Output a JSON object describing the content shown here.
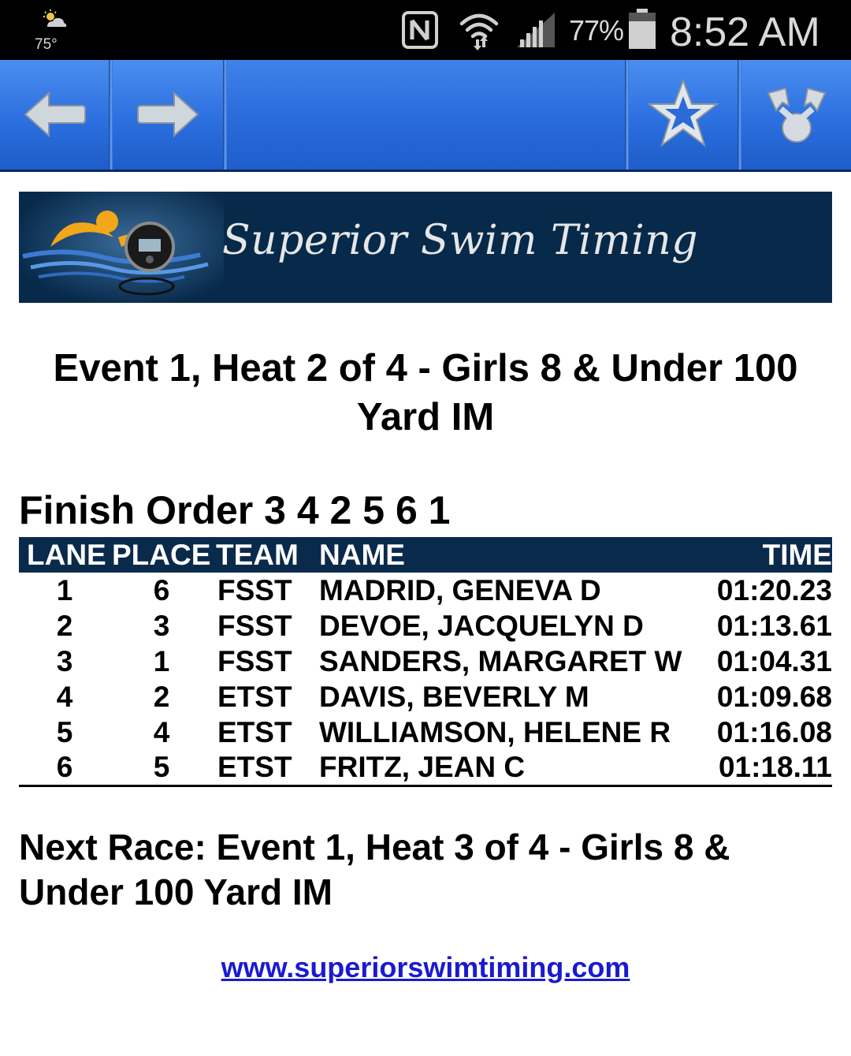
{
  "status_bar": {
    "weather_temp": "75°",
    "weather_icon": "partly-cloudy-icon",
    "nfc_icon": "nfc-icon",
    "wifi_icon": "wifi-icon",
    "signal_icon": "cell-signal-icon",
    "battery_percent": "77%",
    "battery_level": 0.77,
    "battery_icon": "battery-icon",
    "time": "8:52 AM"
  },
  "toolbar": {
    "back_icon": "arrow-left-icon",
    "forward_icon": "arrow-right-icon",
    "favorite_icon": "star-icon",
    "share_icon": "share-icon",
    "color": "#2f73e0"
  },
  "banner": {
    "title": "Superior Swim Timing",
    "background_color": "#07294a"
  },
  "event": {
    "title": "Event 1, Heat 2 of 4 - Girls 8 & Under 100 Yard IM"
  },
  "finish_order": {
    "text": "Finish Order 3 4 2 5 6 1"
  },
  "results": {
    "headers": {
      "lane": "LANE",
      "place": "PLACE",
      "team": "TEAM",
      "name": "NAME",
      "time": "TIME"
    },
    "rows": [
      {
        "lane": "1",
        "place": "6",
        "team": "FSST",
        "name": "MADRID, GENEVA D",
        "time": "01:20.23"
      },
      {
        "lane": "2",
        "place": "3",
        "team": "FSST",
        "name": "DEVOE, JACQUELYN D",
        "time": "01:13.61"
      },
      {
        "lane": "3",
        "place": "1",
        "team": "FSST",
        "name": "SANDERS, MARGARET W",
        "time": "01:04.31"
      },
      {
        "lane": "4",
        "place": "2",
        "team": "ETST",
        "name": "DAVIS, BEVERLY M",
        "time": "01:09.68"
      },
      {
        "lane": "5",
        "place": "4",
        "team": "ETST",
        "name": "WILLIAMSON, HELENE R",
        "time": "01:16.08"
      },
      {
        "lane": "6",
        "place": "5",
        "team": "ETST",
        "name": "FRITZ, JEAN C",
        "time": "01:18.11"
      }
    ]
  },
  "next_race": {
    "text": "Next Race: Event 1, Heat 3 of 4 - Girls 8 & Under 100 Yard IM"
  },
  "footer": {
    "link_text": "www.superiorswimtiming.com",
    "link_color": "#1a1ad0"
  }
}
